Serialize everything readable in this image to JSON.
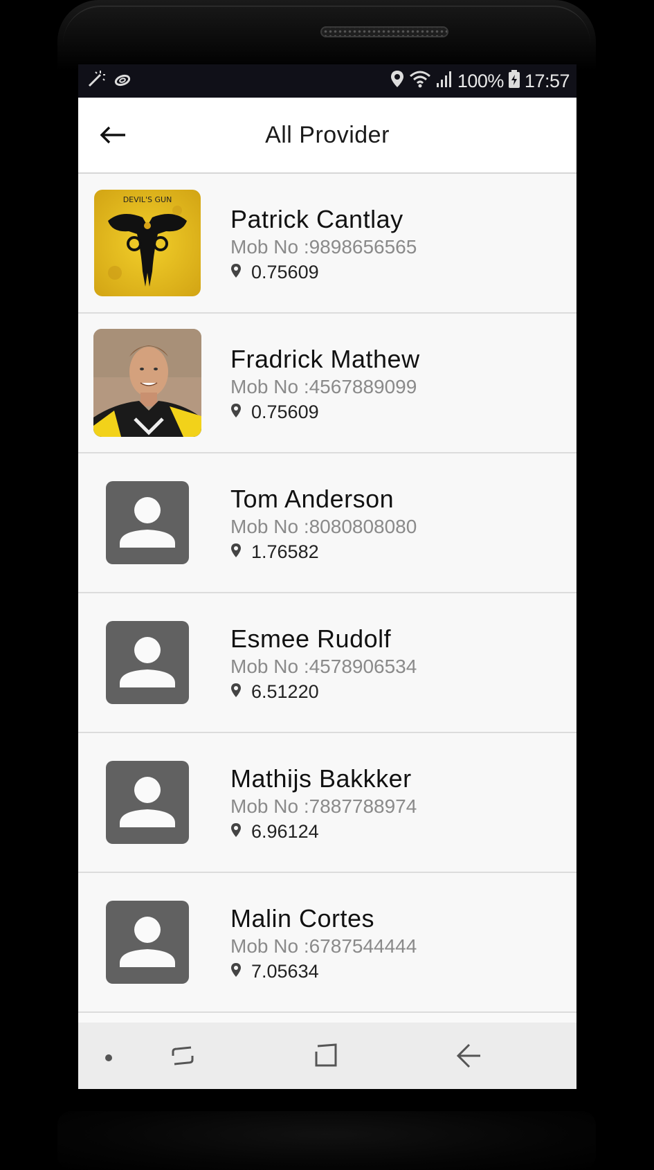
{
  "status_bar": {
    "left_icons": [
      "magic-wand-icon",
      "sync-icon"
    ],
    "right_icons": [
      "location-icon",
      "wifi-icon",
      "signal-icon",
      "battery-icon"
    ],
    "battery": "100%",
    "time": "17:57"
  },
  "app_bar": {
    "title": "All Provider",
    "back_icon": "arrow-left-icon"
  },
  "providers": [
    {
      "name": "Patrick Cantlay",
      "mob": "Mob No :9898656565",
      "distance": "0.75609",
      "avatar": "photo-yellow-poster",
      "avatar_text": "DEVIL'S GUN"
    },
    {
      "name": "Fradrick Mathew",
      "mob": "Mob No :4567889099",
      "distance": "0.75609",
      "avatar": "photo-man"
    },
    {
      "name": "Tom Anderson",
      "mob": "Mob No :8080808080",
      "distance": "1.76582",
      "avatar": "default-person-icon"
    },
    {
      "name": "Esmee Rudolf",
      "mob": "Mob No :4578906534",
      "distance": "6.51220",
      "avatar": "default-person-icon"
    },
    {
      "name": "Mathijs Bakkker",
      "mob": "Mob No :7887788974",
      "distance": "6.96124",
      "avatar": "default-person-icon"
    },
    {
      "name": "Malin Cortes",
      "mob": "Mob No :6787544444",
      "distance": "7.05634",
      "avatar": "default-person-icon"
    }
  ],
  "nav_bar": {
    "items": [
      "dot-icon",
      "recents-icon",
      "home-icon",
      "back-icon"
    ]
  },
  "colors": {
    "status_bar_bg": "#101018",
    "list_bg": "#f8f8f8",
    "divider": "#dcdcdc",
    "placeholder_avatar": "#616161",
    "mob_text": "#8a8a8a"
  }
}
